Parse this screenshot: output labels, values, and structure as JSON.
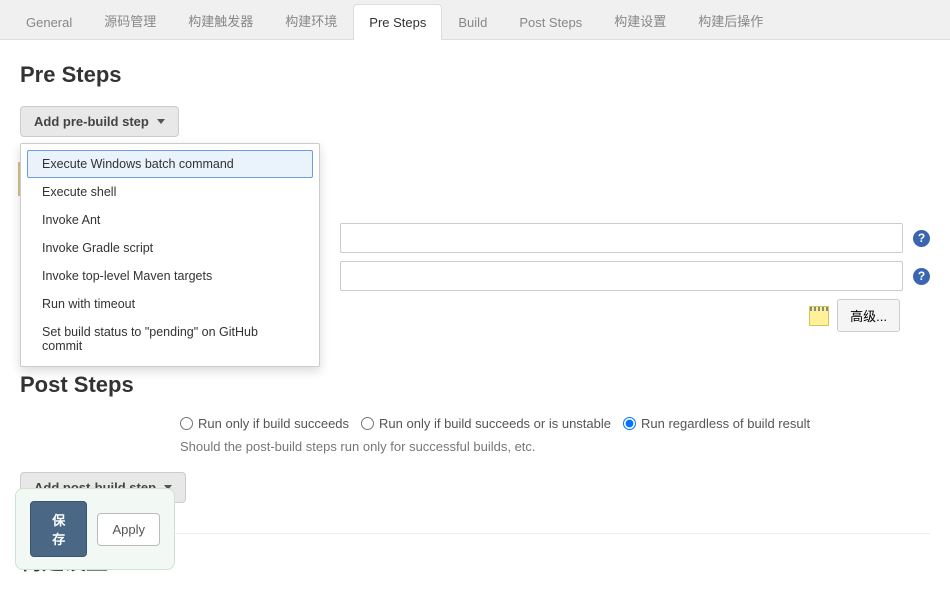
{
  "tabs": {
    "items": [
      {
        "label": "General"
      },
      {
        "label": "源码管理"
      },
      {
        "label": "构建触发器"
      },
      {
        "label": "构建环境"
      },
      {
        "label": "Pre Steps"
      },
      {
        "label": "Build"
      },
      {
        "label": "Post Steps"
      },
      {
        "label": "构建设置"
      },
      {
        "label": "构建后操作"
      }
    ],
    "active_index": 4
  },
  "pre_steps": {
    "title": "Pre Steps",
    "add_button": "Add pre-build step",
    "dropdown": [
      "Execute Windows batch command",
      "Execute shell",
      "Invoke Ant",
      "Invoke Gradle script",
      "Invoke top-level Maven targets",
      "Run with timeout",
      "Set build status to \"pending\" on GitHub commit"
    ],
    "highlight_index": 0
  },
  "build": {
    "field1_value": "",
    "field2_value": "",
    "advanced_label": "高级..."
  },
  "post_steps": {
    "title": "Post Steps",
    "radios": [
      {
        "label": "Run only if build succeeds"
      },
      {
        "label": "Run only if build succeeds or is unstable"
      },
      {
        "label": "Run regardless of build result"
      }
    ],
    "selected_index": 2,
    "description": "Should the post-build steps run only for successful builds, etc.",
    "add_button": "Add post-build step"
  },
  "settings_section": {
    "title": "构建设置"
  },
  "footer": {
    "save": "保存",
    "apply": "Apply"
  }
}
